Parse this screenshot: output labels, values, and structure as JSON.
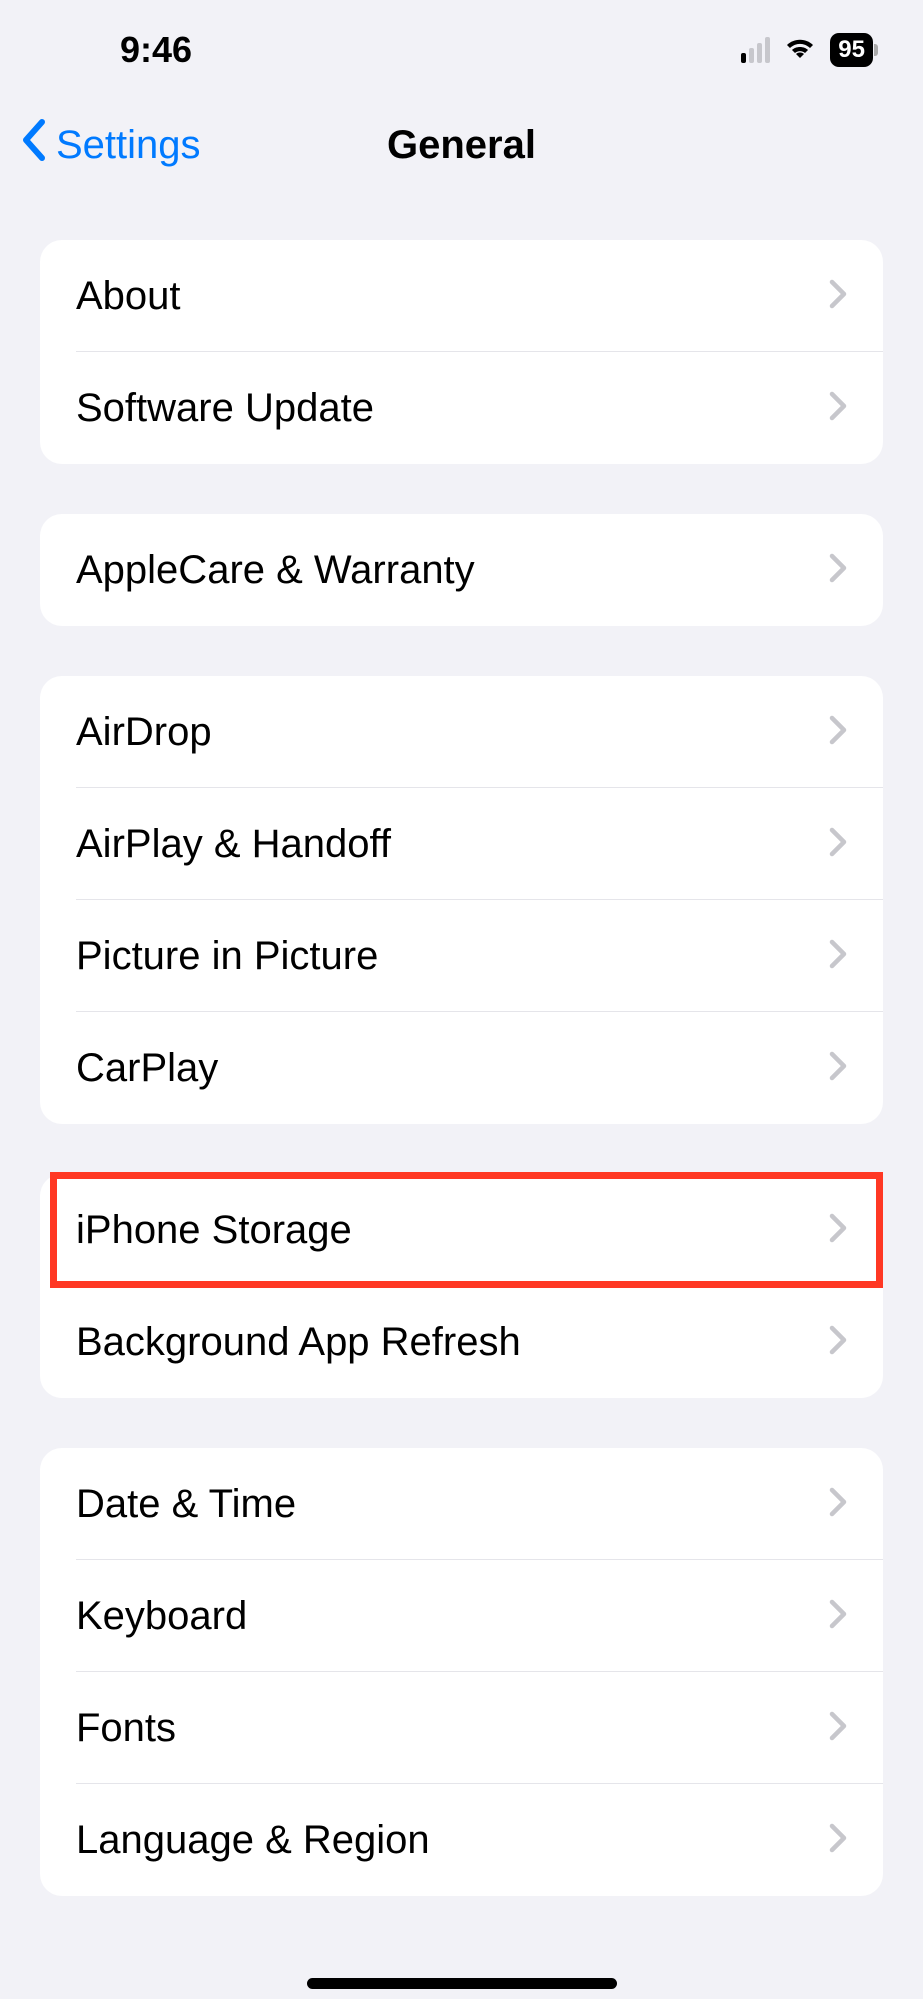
{
  "statusBar": {
    "time": "9:46",
    "battery": "95"
  },
  "nav": {
    "backLabel": "Settings",
    "title": "General"
  },
  "groups": [
    {
      "rows": [
        {
          "id": "about",
          "label": "About"
        },
        {
          "id": "software-update",
          "label": "Software Update"
        }
      ]
    },
    {
      "rows": [
        {
          "id": "applecare-warranty",
          "label": "AppleCare & Warranty"
        }
      ]
    },
    {
      "rows": [
        {
          "id": "airdrop",
          "label": "AirDrop"
        },
        {
          "id": "airplay-handoff",
          "label": "AirPlay & Handoff"
        },
        {
          "id": "picture-in-picture",
          "label": "Picture in Picture"
        },
        {
          "id": "carplay",
          "label": "CarPlay"
        }
      ]
    },
    {
      "rows": [
        {
          "id": "iphone-storage",
          "label": "iPhone Storage",
          "highlighted": true
        },
        {
          "id": "background-app-refresh",
          "label": "Background App Refresh"
        }
      ]
    },
    {
      "rows": [
        {
          "id": "date-time",
          "label": "Date & Time"
        },
        {
          "id": "keyboard",
          "label": "Keyboard"
        },
        {
          "id": "fonts",
          "label": "Fonts"
        },
        {
          "id": "language-region",
          "label": "Language & Region"
        }
      ]
    }
  ]
}
